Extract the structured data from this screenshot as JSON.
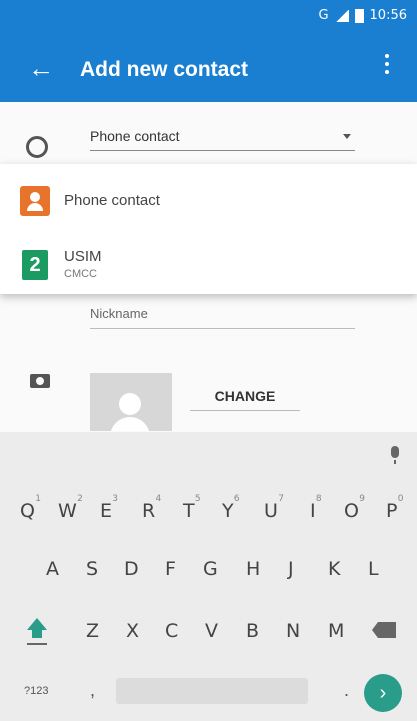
{
  "status_bar": {
    "network": "G",
    "time": "10:56"
  },
  "app_bar": {
    "back_glyph": "←",
    "title": "Add new contact",
    "menu_icon": "more-vert-icon"
  },
  "account_select": {
    "value": "Phone contact"
  },
  "account_dropdown": {
    "items": [
      {
        "label": "Phone contact",
        "icon": "phone-contact-icon",
        "color": "#e8742c"
      },
      {
        "label": "USIM",
        "sublabel": "CMCC",
        "icon_text": "2",
        "icon": "sim-card-icon",
        "color": "#1b9b62"
      }
    ]
  },
  "form": {
    "nickname_placeholder": "Nickname",
    "photo_change_label": "CHANGE"
  },
  "keyboard": {
    "row1": [
      {
        "key": "Q",
        "hint": "1"
      },
      {
        "key": "W",
        "hint": "2"
      },
      {
        "key": "E",
        "hint": "3"
      },
      {
        "key": "R",
        "hint": "4"
      },
      {
        "key": "T",
        "hint": "5"
      },
      {
        "key": "Y",
        "hint": "6"
      },
      {
        "key": "U",
        "hint": "7"
      },
      {
        "key": "I",
        "hint": "8"
      },
      {
        "key": "O",
        "hint": "9"
      },
      {
        "key": "P",
        "hint": "0"
      }
    ],
    "row2": [
      "A",
      "S",
      "D",
      "F",
      "G",
      "H",
      "J",
      "K",
      "L"
    ],
    "row3": [
      "Z",
      "X",
      "C",
      "V",
      "B",
      "N",
      "M"
    ],
    "symbols_label": "?123",
    "comma": ",",
    "period": ".",
    "go_glyph": "›",
    "accent_color": "#2a9c8a"
  },
  "colors": {
    "primary": "#1a7fd0",
    "keyboard_bg": "#ececec"
  }
}
